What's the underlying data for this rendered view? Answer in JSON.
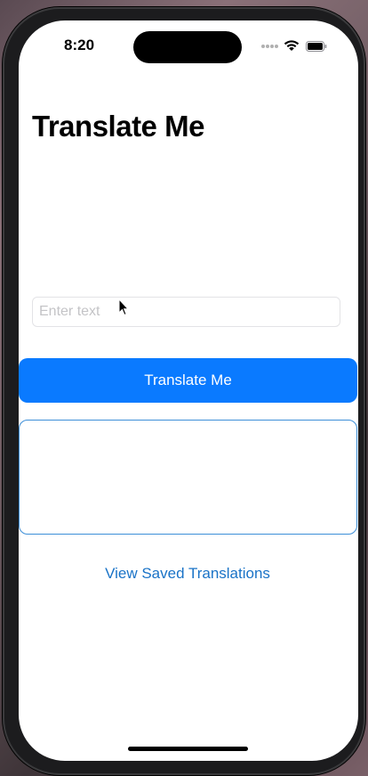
{
  "status_bar": {
    "time": "8:20"
  },
  "main": {
    "title": "Translate Me",
    "input": {
      "placeholder": "Enter text",
      "value": ""
    },
    "translate_button_label": "Translate Me",
    "result_text": "",
    "saved_link_label": "View Saved Translations"
  },
  "colors": {
    "accent": "#0a7aff",
    "link": "#1a73c7",
    "result_border": "#3d8fd8"
  }
}
